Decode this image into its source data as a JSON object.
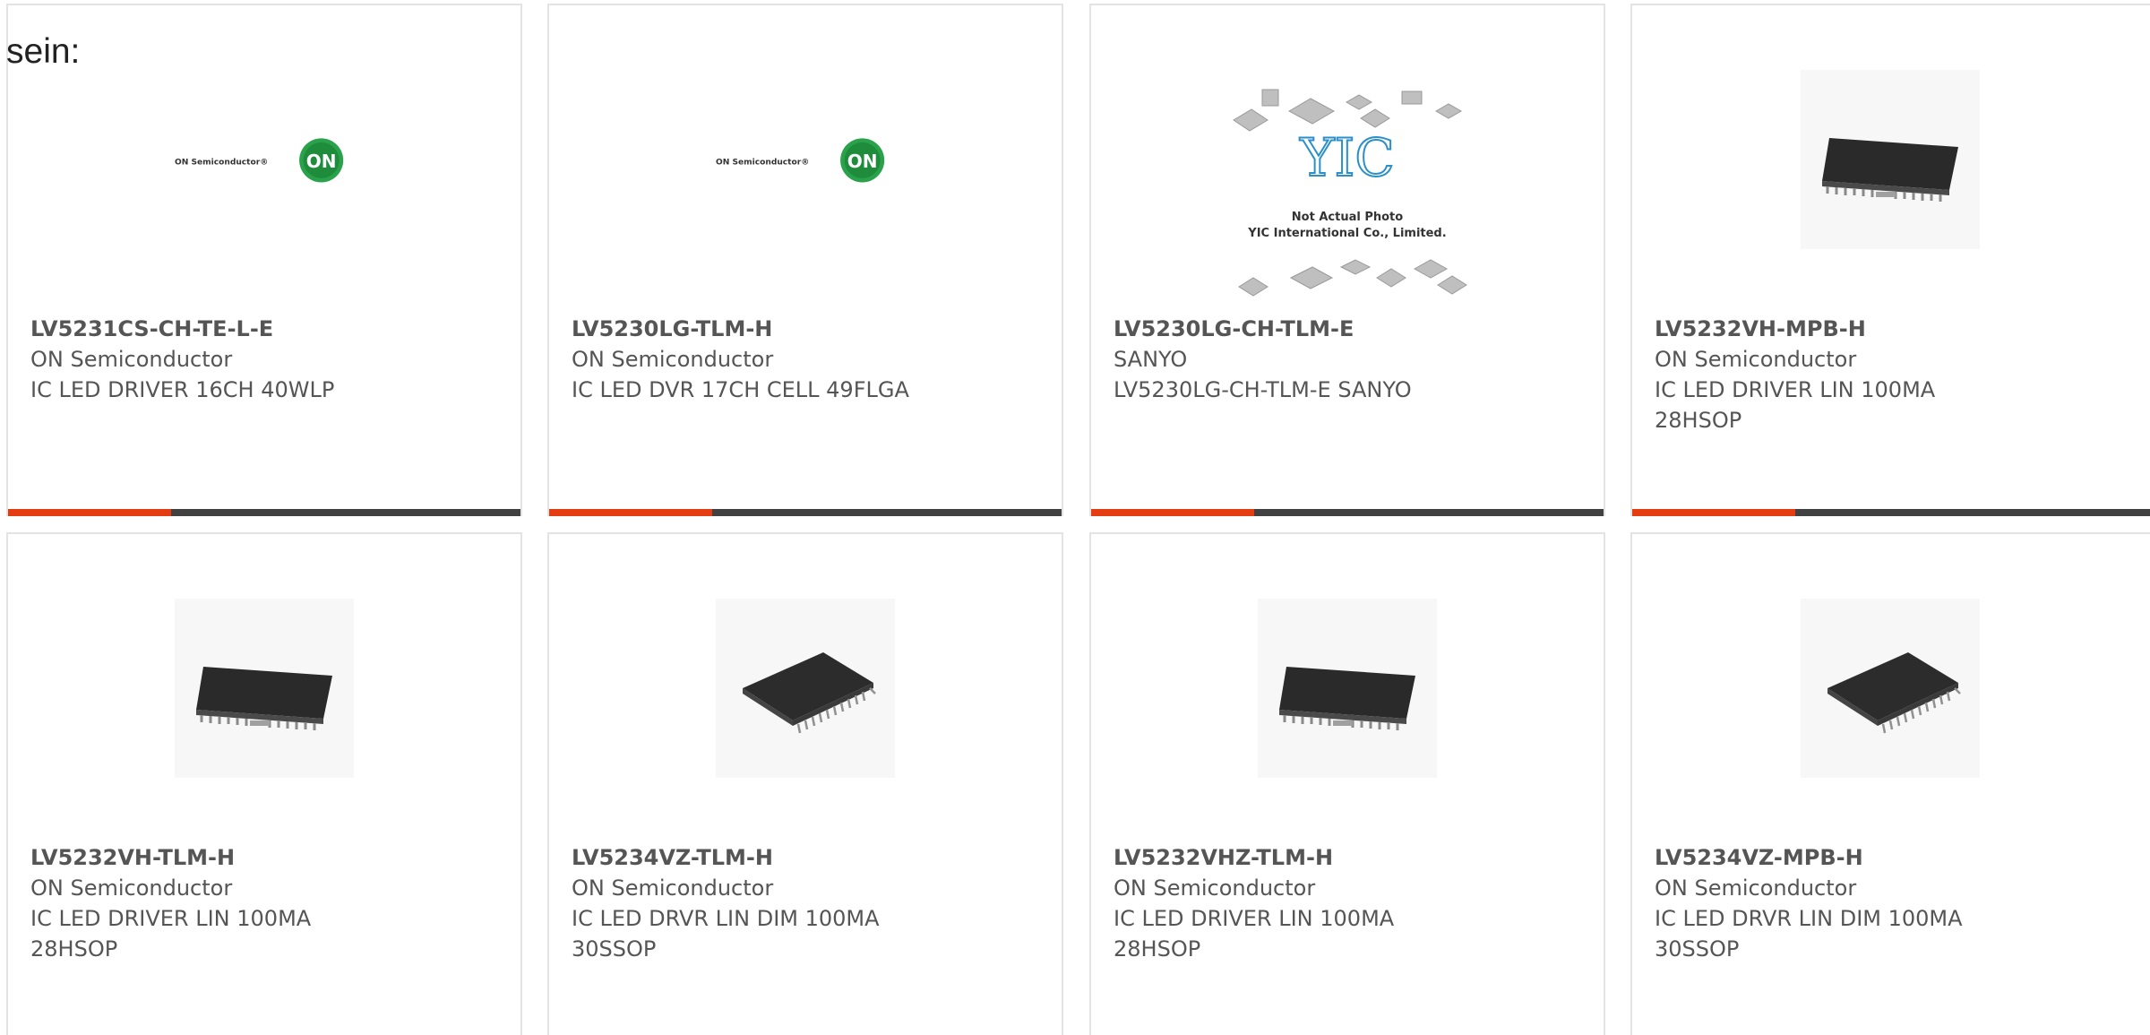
{
  "lead_text": "sein:",
  "accent_color": "#e43d12",
  "bar_color": "#414141",
  "brand": {
    "on_semi_text": "ON Semiconductor",
    "on_logo_text": "ON",
    "yic_logo_text": "YIC",
    "yic_caption_1": "Not Actual Photo",
    "yic_caption_2": "YIC International Co., Limited."
  },
  "products": [
    {
      "part": "LV5231CS-CH-TE-L-E",
      "maker": "ON Semiconductor",
      "desc": "IC LED DRIVER 16CH 40WLP",
      "image": "on-semi-logo"
    },
    {
      "part": "LV5230LG-TLM-H",
      "maker": "ON Semiconductor",
      "desc": "IC LED DVR 17CH CELL 49FLGA",
      "image": "on-semi-logo"
    },
    {
      "part": "LV5230LG-CH-TLM-E",
      "maker": "SANYO",
      "desc": "LV5230LG-CH-TLM-E SANYO",
      "image": "yic-placeholder"
    },
    {
      "part": "LV5232VH-MPB-H",
      "maker": "ON Semiconductor",
      "desc": "IC LED DRIVER LIN 100MA 28HSOP",
      "image": "hsop-chip"
    },
    {
      "part": "LV5232VH-TLM-H",
      "maker": "ON Semiconductor",
      "desc": "IC LED DRIVER LIN 100MA 28HSOP",
      "image": "hsop-chip"
    },
    {
      "part": "LV5234VZ-TLM-H",
      "maker": "ON Semiconductor",
      "desc": "IC LED DRVR LIN DIM 100MA 30SSOP",
      "image": "ssop-chip"
    },
    {
      "part": "LV5232VHZ-TLM-H",
      "maker": "ON Semiconductor",
      "desc": "IC LED DRIVER LIN 100MA 28HSOP",
      "image": "hsop-chip"
    },
    {
      "part": "LV5234VZ-MPB-H",
      "maker": "ON Semiconductor",
      "desc": "IC LED DRVR LIN DIM 100MA 30SSOP",
      "image": "ssop-chip"
    }
  ]
}
